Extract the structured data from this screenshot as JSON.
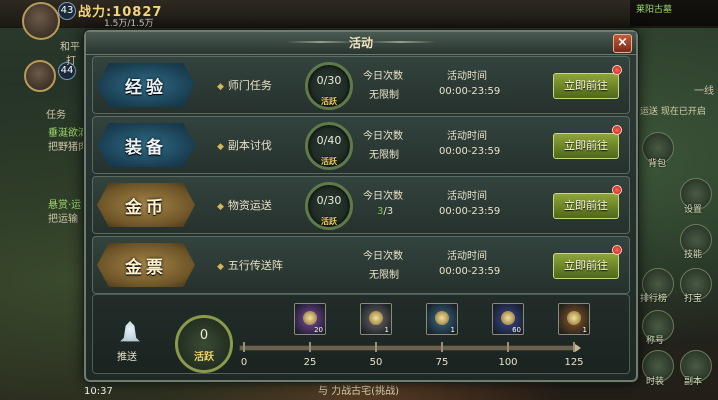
{
  "hud": {
    "player1_level": "43",
    "player2_level": "44",
    "power": "战力:10827",
    "hp": "1.5万/1.5万",
    "name_left1": "和平",
    "name_left2": "打",
    "time": "10:37",
    "map_title": "莱阳古墓",
    "side_tab": "任务",
    "quest1_title": "垂涎欲滴",
    "quest1_desc": "把野猪肉",
    "quest2_title": "悬赏·运",
    "quest2_desc": "把运输",
    "right_labels": [
      "背包",
      "设置",
      "技能",
      "打宝",
      "称号",
      "副本",
      "时装",
      "排行榜"
    ],
    "right_notice": "运送 现在已开启",
    "bottom_text1": "与 力战古宅(挑战)",
    "bottom_line": "一线"
  },
  "dialog": {
    "title": "活动",
    "close_icon": "close-icon",
    "rows": [
      {
        "badge": "经验",
        "badge_color": "blue",
        "task": "师门任务",
        "progress": "0/30",
        "progress_label": "活跃",
        "count_label": "今日次数",
        "count_value": "无限制",
        "count_value_done": "",
        "time_label": "活动时间",
        "time_value": "00:00-23:59",
        "button": "立即前往"
      },
      {
        "badge": "装备",
        "badge_color": "blue",
        "task": "副本讨伐",
        "progress": "0/40",
        "progress_label": "活跃",
        "count_label": "今日次数",
        "count_value": "无限制",
        "count_value_done": "",
        "time_label": "活动时间",
        "time_value": "00:00-23:59",
        "button": "立即前往"
      },
      {
        "badge": "金币",
        "badge_color": "gold",
        "task": "物资运送",
        "progress": "0/30",
        "progress_label": "活跃",
        "count_label": "今日次数",
        "count_value": "/3",
        "count_value_done": "3",
        "time_label": "活动时间",
        "time_value": "00:00-23:59",
        "button": "立即前往"
      },
      {
        "badge": "金票",
        "badge_color": "gold",
        "task": "五行传送阵",
        "progress": "",
        "progress_label": "",
        "count_label": "今日次数",
        "count_value": "无限制",
        "count_value_done": "",
        "time_label": "活动时间",
        "time_value": "00:00-23:59",
        "button": "立即前往"
      }
    ],
    "progress": {
      "push_label": "推送",
      "current": "0",
      "current_label": "活跃",
      "current_fraction": 0,
      "ticks": [
        "0",
        "25",
        "50",
        "75",
        "100",
        "125"
      ],
      "rewards": [
        {
          "qty": "20",
          "frame_color": "#7a4aa8"
        },
        {
          "qty": "1",
          "frame_color": "#6a6a6a"
        },
        {
          "qty": "1",
          "frame_color": "#3a6a8a"
        },
        {
          "qty": "60",
          "frame_color": "#3a4a9a"
        },
        {
          "qty": "1",
          "frame_color": "#8a5a2a"
        }
      ]
    }
  }
}
